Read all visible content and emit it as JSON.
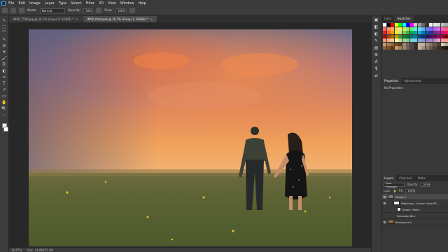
{
  "menubar": {
    "logo": "Ps",
    "items": [
      "File",
      "Edit",
      "Image",
      "Layer",
      "Type",
      "Select",
      "Filter",
      "3D",
      "View",
      "Window",
      "Help"
    ]
  },
  "options": {
    "mode_label": "Mode:",
    "mode_value": "Normal",
    "opacity_label": "Opacity:",
    "opacity_value": "20%",
    "flow_label": "Flow:",
    "flow_value": "100%"
  },
  "tabs": [
    {
      "label": "IMSP_7599.jpg @ 16.7% (Layer 0, RGB/8) *",
      "active": false
    },
    {
      "label": "IMSP_fhdd.psd @ 16.7% (Group 1, RGB/8) *",
      "active": true
    }
  ],
  "tools": [
    "↖",
    "⬚",
    "⌒",
    "✎",
    "⊘",
    "✦",
    "🖌",
    "⎘",
    "◐",
    "✑",
    "T",
    "↗",
    "▭",
    "✋",
    "🔍",
    "⋯"
  ],
  "status": {
    "zoom": "16.67%",
    "doc": "Doc: 74.6M/57.2M"
  },
  "right_icons": [
    "▣",
    "◧",
    "◐",
    "✎",
    "▤",
    "⚙",
    "A",
    "¶",
    "⇄"
  ],
  "panels": {
    "top_tabs": [
      "Color",
      "Swatches"
    ],
    "top_active": 1,
    "props_tabs": [
      "Properties",
      "Adjustments"
    ],
    "props_active": 0,
    "props_text": "No Properties",
    "layers_tabs": [
      "Layers",
      "Channels",
      "Paths"
    ],
    "layers_active": 0,
    "blend_mode": "Pass Through",
    "opacity_label": "Opacity:",
    "opacity_value": "100%",
    "lock_label": "Lock:",
    "fill_label": "Fill:",
    "fill_value": "100%",
    "layers": [
      {
        "name": "Group 1",
        "kind": "folder",
        "selected": true
      },
      {
        "name": "Watchout - Scenic Glow P5",
        "kind": "photo",
        "selected": false
      },
      {
        "name": "Smart Filters",
        "kind": "smart",
        "selected": false
      },
      {
        "name": "Gaussian Blur",
        "kind": "filter",
        "selected": false
      },
      {
        "name": "Background",
        "kind": "photo",
        "selected": false
      }
    ]
  },
  "colors": {
    "accent": "#31a8ff",
    "swatch_row1": [
      "#ffffff",
      "#000000",
      "#ff0000",
      "#ffff00",
      "#00ff00",
      "#00ffff",
      "#0000ff",
      "#ff00ff",
      "#cccccc",
      "#999999",
      "#666666",
      "#333333",
      "#f2f2f2",
      "#e6e6e6",
      "#d9d9d9",
      "#bfbfbf",
      "#a6a6a6"
    ],
    "palette_rows": [
      [
        "#ff6b6b",
        "#ff8e5e",
        "#ffb05e",
        "#ffd25e",
        "#f7f05e",
        "#c9f05e",
        "#8ef05e",
        "#5ef08e",
        "#5ef0c9",
        "#5ee1f0",
        "#5eb0f0",
        "#5e80f0",
        "#7e5ef0",
        "#b05ef0",
        "#e15ef0",
        "#f05eb0",
        "#f05e80"
      ],
      [
        "#ee1c24",
        "#f26522",
        "#f7941d",
        "#fff200",
        "#c4df9b",
        "#8dc63f",
        "#39b54a",
        "#00a651",
        "#00a99d",
        "#00aeef",
        "#0072bc",
        "#0054a6",
        "#2e3192",
        "#662d91",
        "#92278f",
        "#ec008c",
        "#ed145b"
      ],
      [
        "#9e0b0f",
        "#a0410d",
        "#a36209",
        "#aba000",
        "#598527",
        "#197b30",
        "#007236",
        "#00746b",
        "#0076a3",
        "#004a80",
        "#003471",
        "#1b1464",
        "#440e62",
        "#630460",
        "#9e005d",
        "#9e0039",
        "#790000"
      ],
      [
        "#f7977a",
        "#f9ad81",
        "#fdc68a",
        "#fff79a",
        "#c4df9b",
        "#a3d39c",
        "#82ca9d",
        "#7bcdc8",
        "#6ecff6",
        "#7ea7d8",
        "#8493ca",
        "#8882be",
        "#a187be",
        "#bc8dbf",
        "#f49ac2",
        "#f6989d",
        "#f5989d"
      ],
      [
        "#c69c6d",
        "#a67c52",
        "#8c6239",
        "#754c24",
        "#603913",
        "#998675",
        "#736357",
        "#534741",
        "#362f2d",
        "#c7b299",
        "#c2b1a1",
        "#a08e7f",
        "#847465",
        "#6a5b4e",
        "#4f4238",
        "#d6c6b3",
        "#b3a08c"
      ],
      [
        "#8c6239",
        "#754c24",
        "#603913",
        "#c69c6d",
        "#a67c52",
        "#998675",
        "#736357",
        "#534741",
        "#362f2d",
        "#c7b299",
        "#a08e7f",
        "#847465",
        "#6a5b4e",
        "#4f4238",
        "#3a2f28",
        "#2a211c",
        "#1c1611"
      ]
    ]
  }
}
